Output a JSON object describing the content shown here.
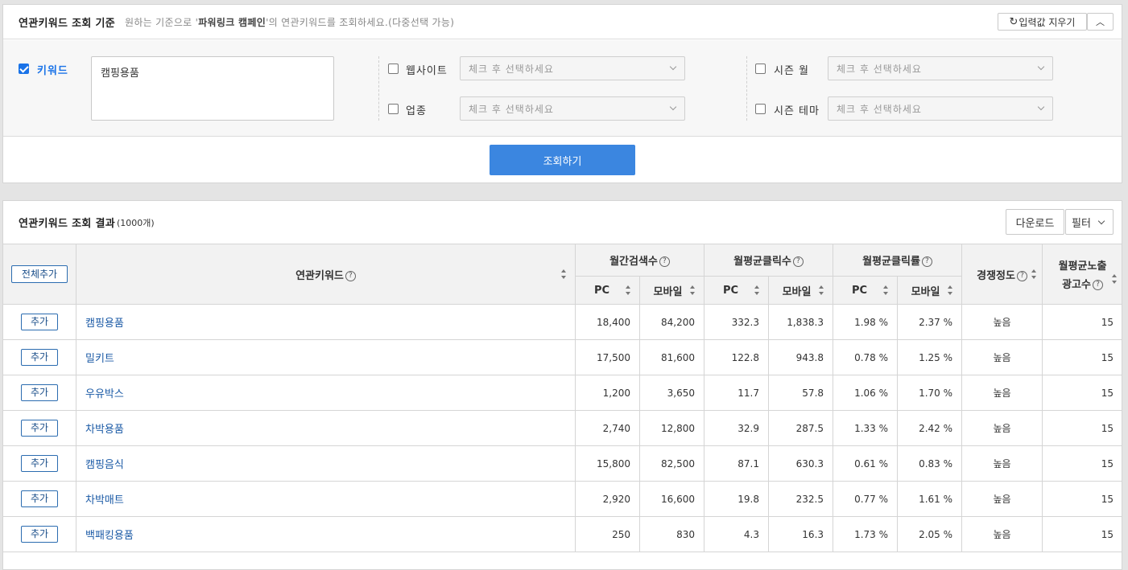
{
  "search": {
    "title": "연관키워드 조회 기준",
    "desc_pre": "원하는 기준으로 '",
    "desc_bold": "파워링크 캠페인",
    "desc_post": "'의 연관키워드를 조회하세요.(다중선택 가능)",
    "reset_label": "입력값 지우기",
    "reset_icon": "↻",
    "collapse_icon": "︿",
    "keyword_label": "키워드",
    "keyword_value": "캠핑용품",
    "website_label": "웹사이트",
    "industry_label": "업종",
    "season_month_label": "시즌 월",
    "season_theme_label": "시즌 테마",
    "select_placeholder": "체크 후 선택하세요",
    "submit_label": "조회하기"
  },
  "results": {
    "title": "연관키워드 조회 결과",
    "count": "(1000개)",
    "download_label": "다운로드",
    "filter_label": "필터",
    "add_all_label": "전체추가",
    "add_label": "추가",
    "columns": {
      "keyword": "연관키워드",
      "monthly_search": "월간검색수",
      "avg_clicks": "월평균클릭수",
      "avg_ctr": "월평균클릭률",
      "competition": "경쟁정도",
      "avg_ads_line1": "월평균노출",
      "avg_ads_line2": "광고수",
      "pc": "PC",
      "mobile": "모바일"
    },
    "rows": [
      {
        "keyword": "캠핑용품",
        "pc_search": "18,400",
        "mo_search": "84,200",
        "pc_clicks": "332.3",
        "mo_clicks": "1,838.3",
        "pc_ctr": "1.98 %",
        "mo_ctr": "2.37 %",
        "competition": "높음",
        "ads": "15"
      },
      {
        "keyword": "밀키트",
        "pc_search": "17,500",
        "mo_search": "81,600",
        "pc_clicks": "122.8",
        "mo_clicks": "943.8",
        "pc_ctr": "0.78 %",
        "mo_ctr": "1.25 %",
        "competition": "높음",
        "ads": "15"
      },
      {
        "keyword": "우유박스",
        "pc_search": "1,200",
        "mo_search": "3,650",
        "pc_clicks": "11.7",
        "mo_clicks": "57.8",
        "pc_ctr": "1.06 %",
        "mo_ctr": "1.70 %",
        "competition": "높음",
        "ads": "15"
      },
      {
        "keyword": "차박용품",
        "pc_search": "2,740",
        "mo_search": "12,800",
        "pc_clicks": "32.9",
        "mo_clicks": "287.5",
        "pc_ctr": "1.33 %",
        "mo_ctr": "2.42 %",
        "competition": "높음",
        "ads": "15"
      },
      {
        "keyword": "캠핑음식",
        "pc_search": "15,800",
        "mo_search": "82,500",
        "pc_clicks": "87.1",
        "mo_clicks": "630.3",
        "pc_ctr": "0.61 %",
        "mo_ctr": "0.83 %",
        "competition": "높음",
        "ads": "15"
      },
      {
        "keyword": "차박매트",
        "pc_search": "2,920",
        "mo_search": "16,600",
        "pc_clicks": "19.8",
        "mo_clicks": "232.5",
        "pc_ctr": "0.77 %",
        "mo_ctr": "1.61 %",
        "competition": "높음",
        "ads": "15"
      },
      {
        "keyword": "백패킹용품",
        "pc_search": "250",
        "mo_search": "830",
        "pc_clicks": "4.3",
        "mo_clicks": "16.3",
        "pc_ctr": "1.73 %",
        "mo_ctr": "2.05 %",
        "competition": "높음",
        "ads": "15"
      }
    ]
  },
  "colors": {
    "accent": "#3b86e0",
    "link": "#1b5aa6",
    "checkbox": "#1a73e8"
  }
}
